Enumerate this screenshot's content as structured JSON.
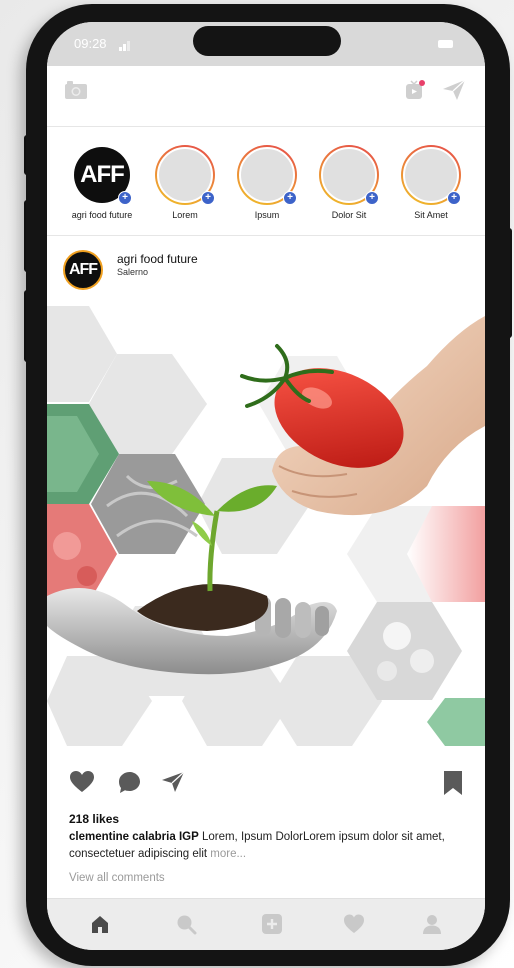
{
  "status_bar": {
    "time": "09:28"
  },
  "stories": [
    {
      "label": "agri food future",
      "logo_text": "AFF",
      "is_own": true
    },
    {
      "label": "Lorem"
    },
    {
      "label": "Ipsum"
    },
    {
      "label": "Dolor Sit"
    },
    {
      "label": "Sit Amet"
    }
  ],
  "post": {
    "username": "agri food future",
    "location": "Salerno",
    "avatar_text": "AFF",
    "likes": "218 likes",
    "caption_user": "clementine calabria IGP",
    "caption_text": " Lorem, Ipsum DolorLorem ipsum dolor sit amet, consectetuer adipiscing elit ",
    "caption_more": "more...",
    "view_comments": "View all comments"
  },
  "icons": {
    "topbar_left": "camera-icon",
    "topbar_right": [
      "tv-icon",
      "send-icon"
    ],
    "actions": [
      "heart-icon",
      "comment-icon",
      "share-icon",
      "bookmark-icon"
    ],
    "nav": [
      "home-icon",
      "search-icon",
      "add-icon",
      "heart-icon",
      "profile-icon"
    ]
  },
  "colors": {
    "notification_dot": "#e8406a",
    "story_badge": "#3d63c9",
    "story_ring_start": "#e64b4b",
    "story_ring_end": "#f0c028",
    "avatar_ring": "#f0a020",
    "icon_gray": "#5a5a5a"
  }
}
